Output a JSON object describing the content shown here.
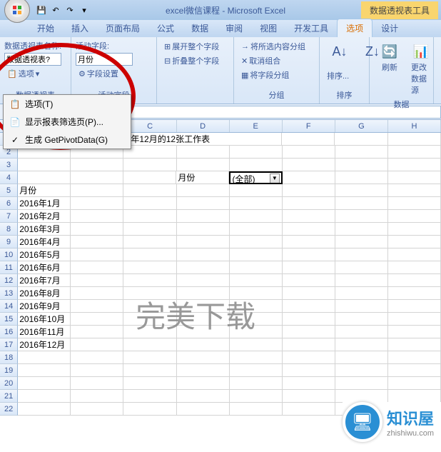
{
  "titlebar": {
    "title": "excel微信课程 - Microsoft Excel",
    "context": "数据透视表工具"
  },
  "tabs": [
    "开始",
    "插入",
    "页面布局",
    "公式",
    "数据",
    "审阅",
    "视图",
    "开发工具",
    "选项",
    "设计"
  ],
  "active_tab_index": 8,
  "ribbon": {
    "pivot_name_label": "数据透视表名称:",
    "pivot_name_value": "数据透视表?",
    "options_btn": "选项",
    "active_field_label": "活动字段:",
    "active_field_value": "月份",
    "field_settings": "字段设置",
    "expand": "展开整个字段",
    "collapse": "折叠整个字段",
    "group_sel": "将所选内容分组",
    "ungroup": "取消组合",
    "group_field": "将字段分组",
    "sort": "排序...",
    "refresh": "刷新",
    "change_source": "更改数据源",
    "group_labels": {
      "pivot": "数据透视表",
      "active": "活动字段",
      "grouping": "分组",
      "sort": "排序",
      "data": "数据"
    }
  },
  "options_menu": {
    "opt": "选项(T)",
    "filter_pages": "显示报表筛选页(P)...",
    "getpivot": "生成 GetPivotData(G)"
  },
  "formula_bar": {
    "value": "(全部)"
  },
  "columns": [
    "A",
    "B",
    "C",
    "D",
    "E",
    "F",
    "G",
    "H"
  ],
  "rows": {
    "1": {
      "A": "目的：新建2016年1月至2016年12月的12张工作表"
    },
    "4": {
      "D": "月份",
      "E": "(全部)"
    },
    "5": {
      "A": "月份"
    },
    "6": {
      "A": "2016年1月"
    },
    "7": {
      "A": "2016年2月"
    },
    "8": {
      "A": "2016年3月"
    },
    "9": {
      "A": "2016年4月"
    },
    "10": {
      "A": "2016年5月"
    },
    "11": {
      "A": "2016年6月"
    },
    "12": {
      "A": "2016年7月"
    },
    "13": {
      "A": "2016年8月"
    },
    "14": {
      "A": "2016年9月"
    },
    "15": {
      "A": "2016年10月"
    },
    "16": {
      "A": "2016年11月"
    },
    "17": {
      "A": "2016年12月"
    }
  },
  "row_count": 22,
  "watermark": "完美下载",
  "logo": {
    "name": "知识屋",
    "url": "zhishiwu.com"
  }
}
